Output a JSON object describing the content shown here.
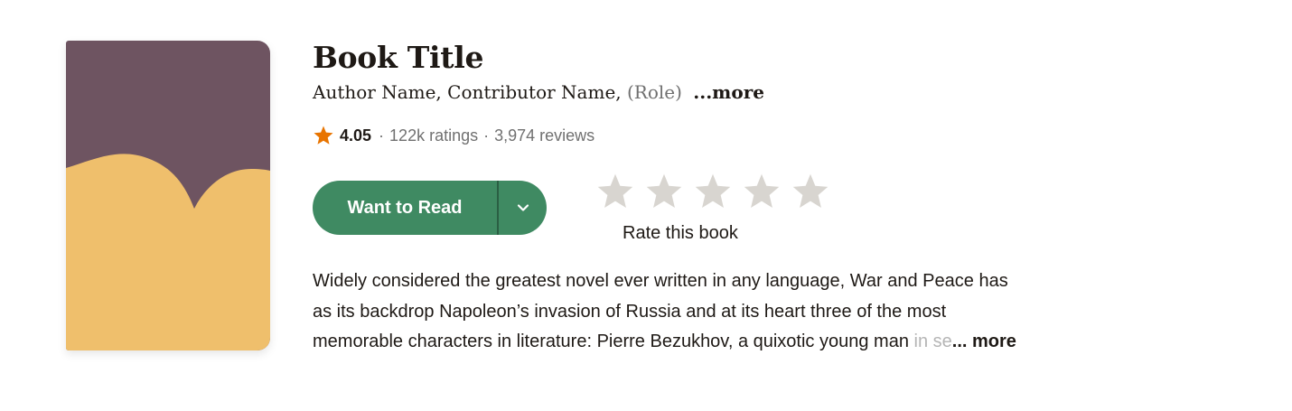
{
  "book": {
    "title": "Book Title",
    "author": "Author Name,",
    "contributor": "Contributor Name,",
    "contributor_role": "(Role)",
    "authors_more": "...more"
  },
  "rating": {
    "average": "4.05",
    "ratings_count": "122k ratings",
    "reviews_count": "3,974 reviews",
    "separator": "·"
  },
  "actions": {
    "want_to_read_label": "Want to Read",
    "rate_label": "Rate this book",
    "rate_stars_count": 5
  },
  "description": {
    "line1": "Widely considered the greatest novel ever written in any language, War and Peace has",
    "line2": "as its backdrop Napoleon’s invasion of Russia and at its heart three of the most",
    "line3": "memorable characters in literature: Pierre Bezukhov, a quixotic young man",
    "line3_faded": " in se",
    "more_label": "... more"
  },
  "colors": {
    "cover_top": "#6e5461",
    "cover_bottom": "#efbf6c",
    "button_green": "#3f8a62",
    "star_orange": "#e87400",
    "empty_star": "#d8d5d0"
  },
  "icons": {
    "rating_star": "star-icon",
    "dropdown": "chevron-down-icon",
    "rate_star": "empty-star-icon"
  }
}
